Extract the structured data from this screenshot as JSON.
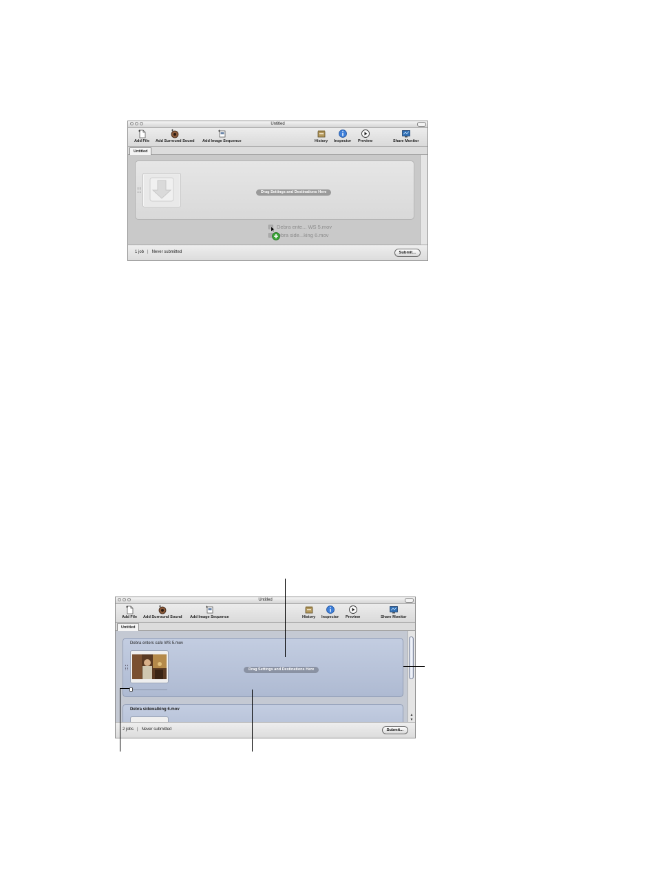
{
  "top_window": {
    "title": "Untitled",
    "toolbar": {
      "add_file": "Add File",
      "add_surround": "Add Surround Sound",
      "add_image_seq": "Add Image Sequence",
      "history": "History",
      "inspector": "Inspector",
      "preview": "Preview",
      "share_monitor": "Share Monitor"
    },
    "tab": "Untitled",
    "drop_hint": "Drag Settings and Destinations Here",
    "dragged_files": [
      "Debra ente... WS 5.mov",
      "ebra side...king 6.mov"
    ],
    "status": {
      "jobs": "1 job",
      "state": "Never submitted"
    },
    "submit": "Submit..."
  },
  "bottom_window": {
    "title": "Untitled",
    "toolbar": {
      "add_file": "Add File",
      "add_surround": "Add Surround Sound",
      "add_image_seq": "Add Image Sequence",
      "history": "History",
      "inspector": "Inspector",
      "preview": "Preview",
      "share_monitor": "Share Monitor"
    },
    "tab": "Untitled",
    "jobs": [
      {
        "name": "Debra enters cafe WS 5.mov",
        "drop_hint": "Drag Settings and Destinations Here"
      },
      {
        "name": "Debra sidewalking 6.mov"
      }
    ],
    "status": {
      "jobs": "2 jobs",
      "state": "Never submitted"
    },
    "submit": "Submit..."
  },
  "icons": [
    "add-file-icon",
    "add-surround-icon",
    "add-image-sequence-icon",
    "history-icon",
    "inspector-icon",
    "preview-icon",
    "share-monitor-icon",
    "drop-arrow-icon",
    "add-plus-icon",
    "cursor-icon"
  ]
}
